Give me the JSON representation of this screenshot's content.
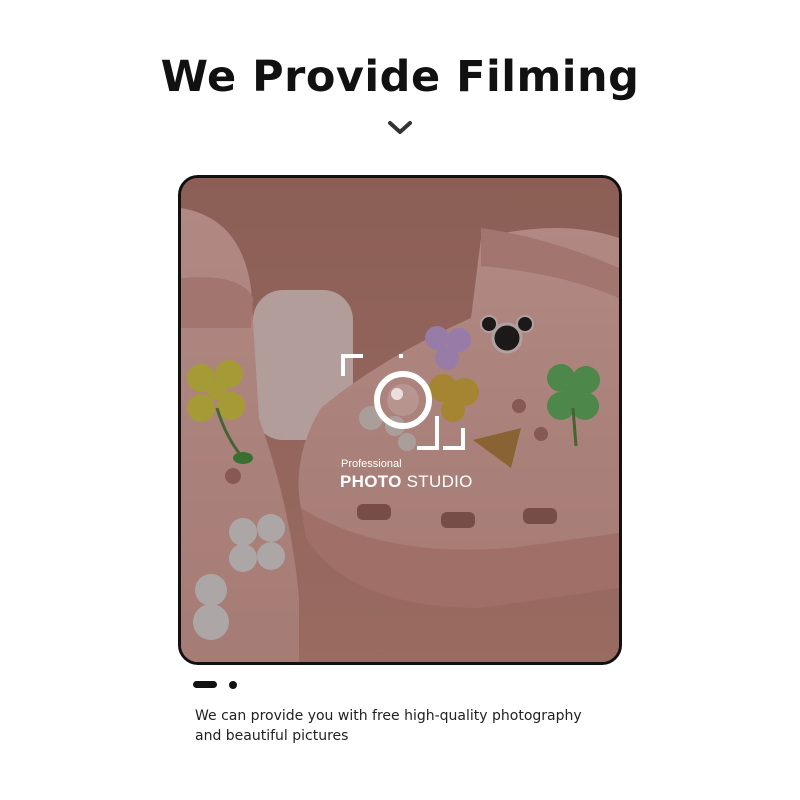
{
  "header": {
    "title": "We Provide Filming"
  },
  "icons": {
    "scroll_indicator": "chevron-down-icon",
    "studio_logo": "camera-icon"
  },
  "photo": {
    "logo_small_text": "Professional",
    "logo_bold_text": "PHOTO",
    "logo_regular_text": "STUDIO"
  },
  "pager": {
    "count": 2,
    "active_index": 0
  },
  "caption": {
    "line1": "We can provide you with free high-quality photography",
    "line2": "and beautiful pictures"
  },
  "colors": {
    "text": "#111111",
    "background": "#ffffff",
    "photo_tone": "#b98a80"
  }
}
